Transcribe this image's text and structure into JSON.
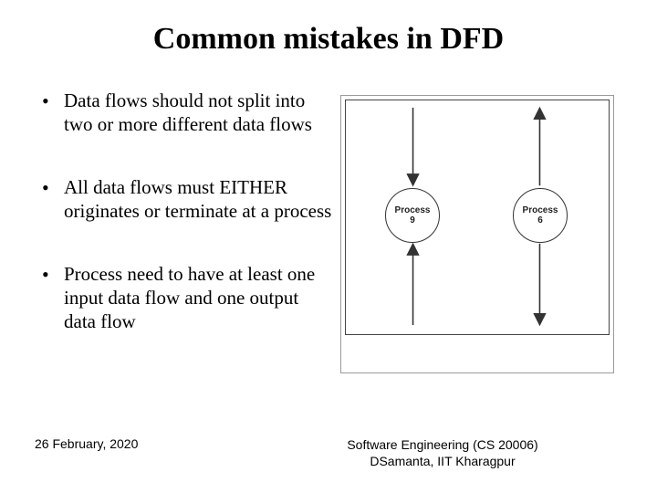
{
  "title": "Common mistakes in DFD",
  "bullets": [
    "Data flows should not split into two or more different data flows",
    "All data flows must EITHER originates or terminate at a process",
    "Process need to have at least one input data flow and one output data flow"
  ],
  "figure": {
    "process_a_label": "Process",
    "process_a_num": "9",
    "process_b_label": "Process",
    "process_b_num": "6"
  },
  "footer": {
    "date": "26 February, 2020",
    "course": "Software Engineering (CS 20006)",
    "author": "DSamanta, IIT Kharagpur"
  }
}
